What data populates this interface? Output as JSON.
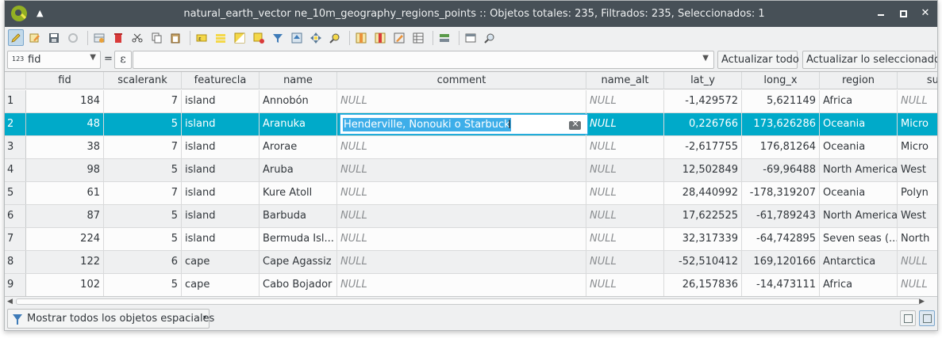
{
  "window": {
    "title": "natural_earth_vector ne_10m_geography_regions_points :: Objetos totales: 235, Filtrados: 235, Seleccionados: 1",
    "collapse_glyph": "▲",
    "close_glyph": "✕"
  },
  "toolbar": {
    "icons": [
      "pencil-edit-icon",
      "multi-edit-icon",
      "save-edits-icon",
      "reload-icon",
      "add-feature-icon",
      "delete-feature-icon",
      "cut-icon",
      "copy-icon",
      "paste-icon",
      "expression-select-icon",
      "select-all-icon",
      "invert-selection-icon",
      "deselect-all-icon",
      "filter-icon",
      "move-selection-top-icon",
      "pan-to-selection-icon",
      "zoom-to-selection-icon",
      "new-field-icon",
      "delete-field-icon",
      "field-calculator-icon",
      "conditional-format-icon",
      "actions-icon",
      "dock-icon",
      "search-icon"
    ]
  },
  "filter": {
    "field_type": "123",
    "field_name": "fid",
    "operator": "=",
    "expression_glyph": "ε",
    "value": "",
    "update_all_label": "Actualizar todo",
    "update_selected_label": "Actualizar lo seleccionado"
  },
  "table": {
    "columns": [
      "fid",
      "scalerank",
      "featurecla",
      "name",
      "comment",
      "name_alt",
      "lat_y",
      "long_x",
      "region",
      "subregion"
    ],
    "column_labels": [
      "fid",
      "scalerank",
      "featurecla",
      "name",
      "comment",
      "name_alt",
      "lat_y",
      "long_x",
      "region",
      "sub"
    ],
    "rows": [
      {
        "n": "1",
        "fid": "184",
        "scalerank": "7",
        "featurecla": "island",
        "name": "Annobón",
        "comment": "NULL",
        "name_alt": "NULL",
        "lat_y": "-1,429572",
        "long_x": "5,621149",
        "region": "Africa",
        "subregion": "NULL"
      },
      {
        "n": "2",
        "fid": "48",
        "scalerank": "5",
        "featurecla": "island",
        "name": "Aranuka",
        "comment": "Henderville, Nonouki o Starbuck",
        "name_alt": "NULL",
        "lat_y": "0,226766",
        "long_x": "173,626286",
        "region": "Oceania",
        "subregion": "Micro"
      },
      {
        "n": "3",
        "fid": "38",
        "scalerank": "7",
        "featurecla": "island",
        "name": "Arorae",
        "comment": "NULL",
        "name_alt": "NULL",
        "lat_y": "-2,617755",
        "long_x": "176,81264",
        "region": "Oceania",
        "subregion": "Micro"
      },
      {
        "n": "4",
        "fid": "98",
        "scalerank": "5",
        "featurecla": "island",
        "name": "Aruba",
        "comment": "NULL",
        "name_alt": "NULL",
        "lat_y": "12,502849",
        "long_x": "-69,96488",
        "region": "North America",
        "subregion": "West"
      },
      {
        "n": "5",
        "fid": "61",
        "scalerank": "7",
        "featurecla": "island",
        "name": "Kure Atoll",
        "comment": "NULL",
        "name_alt": "NULL",
        "lat_y": "28,440992",
        "long_x": "-178,319207",
        "region": "Oceania",
        "subregion": "Polyn"
      },
      {
        "n": "6",
        "fid": "87",
        "scalerank": "5",
        "featurecla": "island",
        "name": "Barbuda",
        "comment": "NULL",
        "name_alt": "NULL",
        "lat_y": "17,622525",
        "long_x": "-61,789243",
        "region": "North America",
        "subregion": "West"
      },
      {
        "n": "7",
        "fid": "224",
        "scalerank": "5",
        "featurecla": "island",
        "name": "Bermuda Isl...",
        "comment": "NULL",
        "name_alt": "NULL",
        "lat_y": "32,317339",
        "long_x": "-64,742895",
        "region": "Seven seas (...",
        "subregion": "North"
      },
      {
        "n": "8",
        "fid": "122",
        "scalerank": "6",
        "featurecla": "cape",
        "name": "Cape Agassiz",
        "comment": "NULL",
        "name_alt": "NULL",
        "lat_y": "-52,510412",
        "long_x": "169,120166",
        "region": "Antarctica",
        "subregion": "NULL"
      },
      {
        "n": "9",
        "fid": "102",
        "scalerank": "5",
        "featurecla": "cape",
        "name": "Cabo Bojador",
        "comment": "NULL",
        "name_alt": "NULL",
        "lat_y": "26,157836",
        "long_x": "-14,473111",
        "region": "Africa",
        "subregion": "NULL"
      }
    ],
    "selected_row": 2,
    "editing": {
      "column": "comment",
      "value": "Henderville, Nonouki o Starbuck"
    }
  },
  "bottom": {
    "show_features_label": "Mostrar todos los objetos espaciales",
    "view_modes": [
      "form-view-icon",
      "table-view-icon"
    ]
  },
  "colors": {
    "selection": "#00aac9",
    "titlebar": "#475057",
    "editor_highlight": "#3daee9"
  }
}
